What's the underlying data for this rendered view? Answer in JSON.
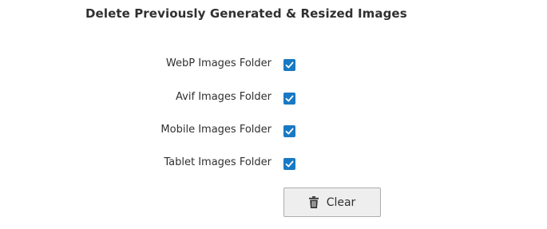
{
  "section": {
    "title": "Delete Previously Generated & Resized Images"
  },
  "fields": [
    {
      "label": "WebP Images Folder",
      "checked": true
    },
    {
      "label": "Avif Images Folder",
      "checked": true
    },
    {
      "label": "Mobile Images Folder",
      "checked": true
    },
    {
      "label": "Tablet Images Folder",
      "checked": true
    }
  ],
  "clear_button": {
    "label": "Clear",
    "icon": "trash-icon"
  },
  "colors": {
    "checkbox_accent": "#1979c3",
    "text": "#303030",
    "button_bg": "#eeeeee",
    "button_border": "#adadad"
  }
}
